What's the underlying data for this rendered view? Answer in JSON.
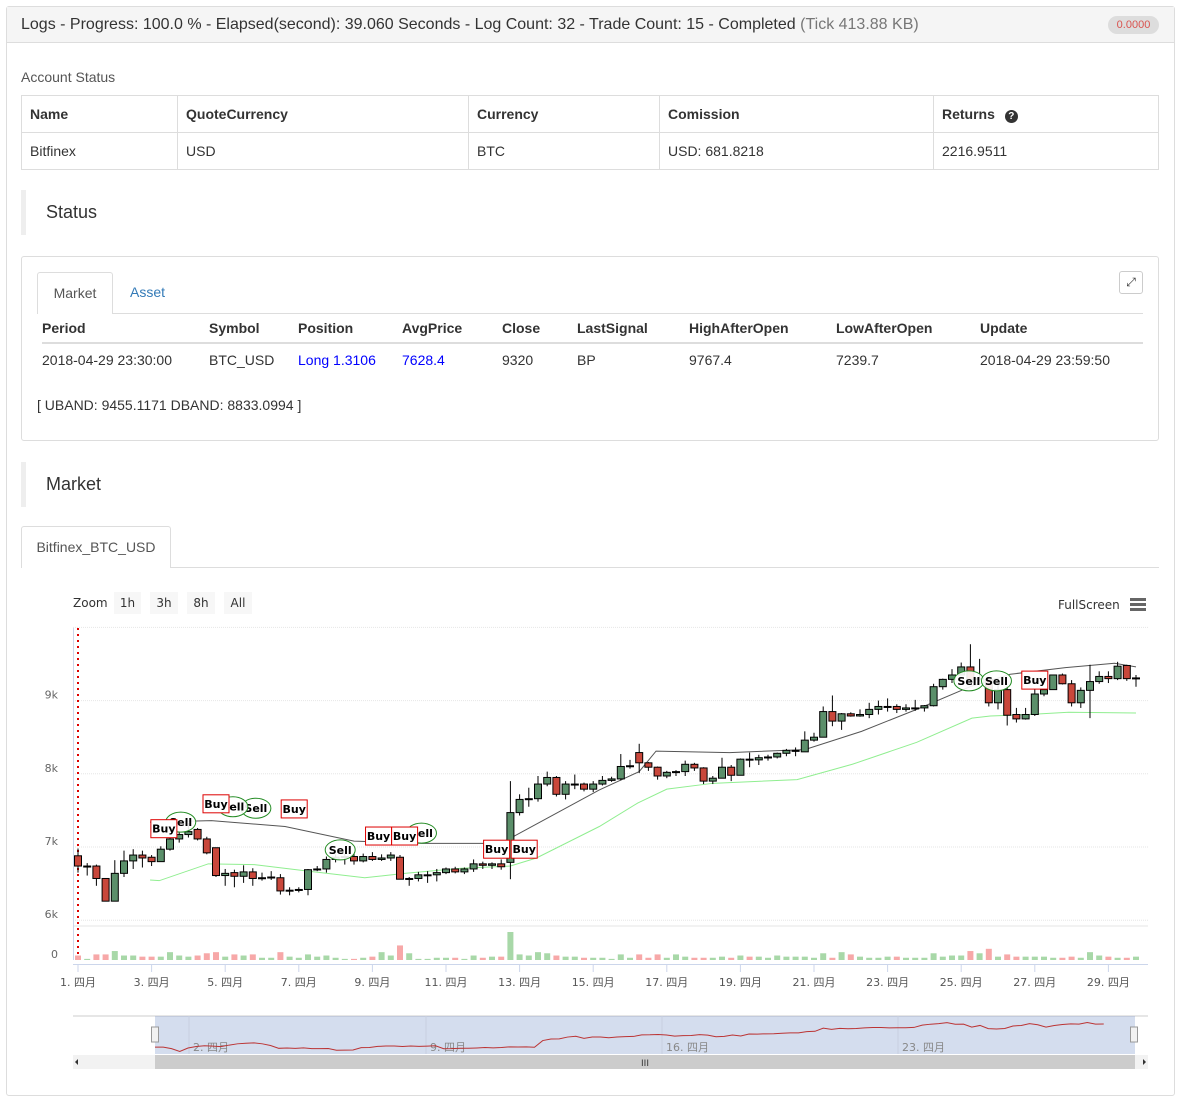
{
  "header": {
    "title": "Logs - Progress: 100.0 % - Elapsed(second): 39.060 Seconds - Log Count: 32 - Trade Count: 15 - Completed",
    "tick": "(Tick 413.88 KB)",
    "badge": "0.0000"
  },
  "account": {
    "label": "Account Status",
    "columns": [
      "Name",
      "QuoteCurrency",
      "Currency",
      "Comission",
      "Returns"
    ],
    "row": [
      "Bitfinex",
      "USD",
      "BTC",
      "USD: 681.8218",
      "2216.9511"
    ],
    "help_icon": "question-circle-icon"
  },
  "status": {
    "title": "Status",
    "tabs": [
      "Market",
      "Asset"
    ],
    "active_tab": "Market",
    "expand_icon": "expand-icon",
    "columns": [
      "Period",
      "Symbol",
      "Position",
      "AvgPrice",
      "Close",
      "LastSignal",
      "HighAfterOpen",
      "LowAfterOpen",
      "Update"
    ],
    "row": [
      "2018-04-29 23:30:00",
      "BTC_USD",
      "Long 1.3106",
      "7628.4",
      "9320",
      "BP",
      "9767.4",
      "7239.7",
      "2018-04-29 23:59:50"
    ],
    "bands": "[ UBAND: 9455.1171 DBAND: 8833.0994 ]",
    "link_color": "#0000ff"
  },
  "market": {
    "title": "Market",
    "tab": "Bitfinex_BTC_USD"
  },
  "chart": {
    "zoom_label": "Zoom",
    "zoom_buttons": [
      "1h",
      "3h",
      "8h",
      "All"
    ],
    "fullscreen": "FullScreen",
    "menu_icon": "hamburger-menu-icon",
    "volume_label": "0",
    "navigator_labels": [
      "2. 四月",
      "9. 四月",
      "16. 四月",
      "23. 四月"
    ],
    "scroll_grip": "III"
  },
  "chart_data": {
    "type": "candlestick",
    "ylim": [
      6000,
      10000
    ],
    "ytick_labels": [
      "6k",
      "7k",
      "8k",
      "9k"
    ],
    "yticks": [
      6000,
      7000,
      8000,
      9000
    ],
    "xtick_labels": [
      "1. 四月",
      "3. 四月",
      "5. 四月",
      "7. 四月",
      "9. 四月",
      "11. 四月",
      "13. 四月",
      "15. 四月",
      "17. 四月",
      "19. 四月",
      "21. 四月",
      "23. 四月",
      "25. 四月",
      "27. 四月",
      "29. 四月"
    ],
    "grid": true,
    "colors": {
      "up": "#5b8f6a",
      "down": "#c9473b",
      "upper_band": "#555555",
      "lower_band": "#90ee90",
      "vol_up": "#a8d8a8",
      "vol_down": "#f7a8a8",
      "buy": "#dd0000",
      "sell": "#228b22"
    },
    "candles": [
      [
        "04-01 00",
        6880,
        6980,
        6650,
        6740
      ],
      [
        "04-01 06",
        6740,
        6780,
        6610,
        6740
      ],
      [
        "04-01 12",
        6740,
        6760,
        6470,
        6570
      ],
      [
        "04-01 18",
        6570,
        6570,
        6260,
        6260
      ],
      [
        "04-02 00",
        6260,
        6820,
        6260,
        6640
      ],
      [
        "04-02 06",
        6640,
        6950,
        6590,
        6810
      ],
      [
        "04-02 12",
        6810,
        6970,
        6700,
        6890
      ],
      [
        "04-02 18",
        6890,
        6950,
        6720,
        6850
      ],
      [
        "04-03 00",
        6860,
        6890,
        6740,
        6800
      ],
      [
        "04-03 06",
        6800,
        7010,
        6800,
        6970
      ],
      [
        "04-03 12",
        6970,
        7170,
        6950,
        7110
      ],
      [
        "04-03 18",
        7110,
        7210,
        7060,
        7170
      ],
      [
        "04-04 00",
        7170,
        7330,
        7130,
        7210
      ],
      [
        "04-04 06",
        7240,
        7260,
        7090,
        7110
      ],
      [
        "04-04 12",
        7110,
        7140,
        6900,
        6920
      ],
      [
        "04-04 18",
        6990,
        6990,
        6590,
        6610
      ],
      [
        "04-05 00",
        6610,
        6700,
        6470,
        6640
      ],
      [
        "04-05 06",
        6650,
        6690,
        6450,
        6600
      ],
      [
        "04-05 12",
        6600,
        6750,
        6510,
        6660
      ],
      [
        "04-05 18",
        6660,
        6710,
        6470,
        6570
      ],
      [
        "04-06 00",
        6570,
        6650,
        6540,
        6580
      ],
      [
        "04-06 06",
        6580,
        6670,
        6550,
        6590
      ],
      [
        "04-06 12",
        6580,
        6630,
        6350,
        6400
      ],
      [
        "04-06 18",
        6400,
        6450,
        6340,
        6410
      ],
      [
        "04-07 00",
        6410,
        6450,
        6380,
        6420
      ],
      [
        "04-07 06",
        6420,
        6700,
        6340,
        6690
      ],
      [
        "04-07 12",
        6690,
        6740,
        6670,
        6700
      ],
      [
        "04-07 18",
        6700,
        6870,
        6650,
        6830
      ],
      [
        "04-08 00",
        6830,
        6900,
        6790,
        6860
      ],
      [
        "04-08 06",
        6860,
        6910,
        6760,
        6870
      ],
      [
        "04-08 12",
        6870,
        6920,
        6760,
        6810
      ],
      [
        "04-08 18",
        6810,
        6910,
        6790,
        6870
      ],
      [
        "04-09 00",
        6870,
        6930,
        6810,
        6830
      ],
      [
        "04-09 06",
        6830,
        6900,
        6810,
        6850
      ],
      [
        "04-09 12",
        6850,
        6930,
        6810,
        6890
      ],
      [
        "04-09 18",
        6860,
        6890,
        6560,
        6560
      ],
      [
        "04-10 00",
        6560,
        6590,
        6470,
        6570
      ],
      [
        "04-10 06",
        6570,
        6660,
        6530,
        6620
      ],
      [
        "04-10 12",
        6620,
        6670,
        6510,
        6620
      ],
      [
        "04-10 18",
        6620,
        6700,
        6530,
        6650
      ],
      [
        "04-11 00",
        6650,
        6720,
        6630,
        6700
      ],
      [
        "04-11 06",
        6700,
        6730,
        6640,
        6660
      ],
      [
        "04-11 12",
        6660,
        6720,
        6630,
        6700
      ],
      [
        "04-11 18",
        6700,
        6830,
        6660,
        6770
      ],
      [
        "04-12 00",
        6770,
        6800,
        6700,
        6750
      ],
      [
        "04-12 06",
        6750,
        6790,
        6700,
        6770
      ],
      [
        "04-12 12",
        6770,
        6830,
        6690,
        6730
      ],
      [
        "04-12 18",
        6790,
        7900,
        6560,
        7470
      ],
      [
        "04-13 00",
        7470,
        7720,
        7430,
        7650
      ],
      [
        "04-13 06",
        7650,
        7810,
        7550,
        7660
      ],
      [
        "04-13 12",
        7660,
        7970,
        7620,
        7860
      ],
      [
        "04-13 18",
        7860,
        8030,
        7830,
        7950
      ],
      [
        "04-14 00",
        7950,
        7970,
        7690,
        7720
      ],
      [
        "04-14 06",
        7720,
        7900,
        7650,
        7860
      ],
      [
        "04-14 12",
        7860,
        7990,
        7790,
        7860
      ],
      [
        "04-14 18",
        7860,
        7880,
        7760,
        7790
      ],
      [
        "04-15 00",
        7790,
        7900,
        7750,
        7860
      ],
      [
        "04-15 06",
        7860,
        7970,
        7840,
        7910
      ],
      [
        "04-15 12",
        7910,
        7960,
        7890,
        7930
      ],
      [
        "04-15 18",
        7930,
        8270,
        7910,
        8100
      ],
      [
        "04-16 00",
        8100,
        8190,
        8070,
        8110
      ],
      [
        "04-16 06",
        8290,
        8410,
        8010,
        8150
      ],
      [
        "04-16 12",
        8150,
        8160,
        8040,
        8090
      ],
      [
        "04-16 18",
        8090,
        8100,
        7920,
        7970
      ],
      [
        "04-17 00",
        7970,
        8040,
        7940,
        8020
      ],
      [
        "04-17 06",
        8020,
        8050,
        7970,
        8030
      ],
      [
        "04-17 12",
        8030,
        8180,
        7970,
        8130
      ],
      [
        "04-17 18",
        8130,
        8150,
        8040,
        8080
      ],
      [
        "04-18 00",
        8080,
        8090,
        7860,
        7900
      ],
      [
        "04-18 06",
        7900,
        7970,
        7860,
        7940
      ],
      [
        "04-18 12",
        7940,
        8220,
        7940,
        8090
      ],
      [
        "04-18 18",
        8090,
        8120,
        7900,
        7980
      ],
      [
        "04-19 00",
        7980,
        8210,
        7980,
        8200
      ],
      [
        "04-19 06",
        8200,
        8290,
        8090,
        8190
      ],
      [
        "04-19 12",
        8190,
        8260,
        8120,
        8220
      ],
      [
        "04-19 18",
        8220,
        8260,
        8180,
        8230
      ],
      [
        "04-20 00",
        8230,
        8290,
        8210,
        8280
      ],
      [
        "04-20 06",
        8280,
        8340,
        8240,
        8320
      ],
      [
        "04-20 12",
        8320,
        8360,
        8240,
        8320
      ],
      [
        "04-20 18",
        8300,
        8580,
        8300,
        8460
      ],
      [
        "04-21 00",
        8460,
        8560,
        8440,
        8500
      ],
      [
        "04-21 06",
        8500,
        8920,
        8500,
        8850
      ],
      [
        "04-21 12",
        8850,
        9070,
        8650,
        8720
      ],
      [
        "04-21 18",
        8720,
        8830,
        8600,
        8820
      ],
      [
        "04-22 00",
        8820,
        8840,
        8780,
        8790
      ],
      [
        "04-22 06",
        8790,
        8880,
        8780,
        8810
      ],
      [
        "04-22 12",
        8810,
        8970,
        8760,
        8880
      ],
      [
        "04-22 18",
        8880,
        9000,
        8810,
        8920
      ],
      [
        "04-23 00",
        8920,
        9030,
        8850,
        8920
      ],
      [
        "04-23 06",
        8920,
        8950,
        8830,
        8880
      ],
      [
        "04-23 12",
        8880,
        8950,
        8850,
        8900
      ],
      [
        "04-23 18",
        8900,
        9010,
        8860,
        8900
      ],
      [
        "04-24 00",
        8900,
        8940,
        8850,
        8930
      ],
      [
        "04-24 06",
        8930,
        9230,
        8920,
        9190
      ],
      [
        "04-24 12",
        9190,
        9300,
        9150,
        9290
      ],
      [
        "04-24 18",
        9290,
        9430,
        9240,
        9350
      ],
      [
        "04-25 00",
        9350,
        9520,
        9350,
        9460
      ],
      [
        "04-25 06",
        9460,
        9770,
        9280,
        9290
      ],
      [
        "04-25 12",
        9290,
        9570,
        9260,
        9300
      ],
      [
        "04-25 18",
        9290,
        9300,
        8920,
        8970
      ],
      [
        "04-26 00",
        8970,
        9300,
        8880,
        9150
      ],
      [
        "04-26 06",
        9150,
        9200,
        8660,
        8800
      ],
      [
        "04-26 12",
        8810,
        8900,
        8700,
        8750
      ],
      [
        "04-26 18",
        8750,
        8900,
        8740,
        8810
      ],
      [
        "04-27 00",
        8810,
        9200,
        8790,
        9090
      ],
      [
        "04-27 06",
        9090,
        9250,
        9060,
        9150
      ],
      [
        "04-27 12",
        9150,
        9350,
        9150,
        9350
      ],
      [
        "04-27 18",
        9350,
        9370,
        9220,
        9230
      ],
      [
        "04-28 00",
        9230,
        9280,
        8920,
        8970
      ],
      [
        "04-28 06",
        8970,
        9180,
        8900,
        9140
      ],
      [
        "04-28 12",
        9140,
        9490,
        8760,
        9260
      ],
      [
        "04-28 18",
        9260,
        9400,
        9230,
        9330
      ],
      [
        "04-29 00",
        9330,
        9400,
        9240,
        9300
      ],
      [
        "04-29 06",
        9300,
        9530,
        9280,
        9470
      ],
      [
        "04-29 12",
        9480,
        9490,
        9270,
        9300
      ],
      [
        "04-29 18",
        9300,
        9350,
        9190,
        9310
      ]
    ],
    "volumes": [
      4,
      1,
      5,
      5,
      8,
      4,
      4,
      3,
      3,
      3,
      7,
      4,
      3,
      4,
      6,
      7,
      3,
      5,
      4,
      5,
      2,
      2,
      7,
      3,
      2,
      5,
      3,
      4,
      2,
      1,
      1,
      2,
      3,
      7,
      4,
      13,
      6,
      1,
      1,
      2,
      2,
      2,
      1,
      4,
      2,
      3,
      3,
      25,
      5,
      4,
      7,
      6,
      4,
      3,
      3,
      2,
      2,
      2,
      1,
      5,
      2,
      5,
      2,
      5,
      2,
      5,
      3,
      2,
      2,
      2,
      3,
      2,
      4,
      3,
      3,
      2,
      4,
      3,
      3,
      3,
      2,
      6,
      2,
      7,
      5,
      3,
      2,
      2,
      3,
      3,
      2,
      2,
      2,
      6,
      3,
      4,
      4,
      8,
      6,
      10,
      3,
      5,
      3,
      3,
      3,
      3,
      2,
      2,
      3,
      2,
      7,
      4,
      3,
      2,
      2,
      3
    ],
    "upper_band": [
      [
        "04-02 23",
        7340
      ],
      [
        "04-04 15",
        7360
      ],
      [
        "04-06 15",
        7280
      ],
      [
        "04-08 12",
        7080
      ],
      [
        "04-10 09",
        7050
      ],
      [
        "04-12 11",
        7050
      ],
      [
        "04-12 18",
        7120
      ],
      [
        "04-15 04",
        7780
      ],
      [
        "04-16 06",
        8030
      ],
      [
        "04-16 17",
        8310
      ],
      [
        "04-18 17",
        8290
      ],
      [
        "04-20 18",
        8330
      ],
      [
        "04-22 07",
        8580
      ],
      [
        "04-23 19",
        8880
      ],
      [
        "04-25 07",
        9200
      ],
      [
        "04-26 08",
        9360
      ],
      [
        "04-27 20",
        9450
      ],
      [
        "04-29 04",
        9510
      ],
      [
        "04-29 18",
        9460
      ]
    ],
    "lower_band": [
      [
        "04-02 23",
        6550
      ],
      [
        "04-03 05",
        6540
      ],
      [
        "04-04 13",
        6770
      ],
      [
        "04-05 19",
        6760
      ],
      [
        "04-07 06",
        6670
      ],
      [
        "04-08 19",
        6580
      ],
      [
        "04-09 21",
        6640
      ],
      [
        "04-11 10",
        6710
      ],
      [
        "04-12 18",
        6740
      ],
      [
        "04-13 11",
        6850
      ],
      [
        "04-15 04",
        7280
      ],
      [
        "04-16 05",
        7600
      ],
      [
        "04-17 00",
        7790
      ],
      [
        "04-18 06",
        7870
      ],
      [
        "04-20 13",
        7920
      ],
      [
        "04-22 01",
        8130
      ],
      [
        "04-23 19",
        8430
      ],
      [
        "04-25 07",
        8760
      ],
      [
        "04-25 19",
        8790
      ],
      [
        "04-26 20",
        8810
      ],
      [
        "04-27 22",
        8840
      ],
      [
        "04-29 18",
        8830
      ]
    ],
    "signals": [
      {
        "time": "04-03 19",
        "price": 7340,
        "type": "sell",
        "text": "Sell"
      },
      {
        "time": "04-03 08",
        "price": 7250,
        "type": "buy",
        "text": "Buy"
      },
      {
        "time": "04-05 20",
        "price": 7530,
        "type": "sell",
        "text": "Sell"
      },
      {
        "time": "04-05 05",
        "price": 7550,
        "type": "sell",
        "text": "Sell"
      },
      {
        "time": "04-04 18",
        "price": 7590,
        "type": "buy",
        "text": "Buy"
      },
      {
        "time": "04-06 21",
        "price": 7520,
        "type": "buy",
        "text": "Buy"
      },
      {
        "time": "04-08 03",
        "price": 6960,
        "type": "sell",
        "text": "Sell"
      },
      {
        "time": "04-10 08",
        "price": 7190,
        "type": "sell",
        "text": "Sell"
      },
      {
        "time": "04-09 21",
        "price": 7150,
        "type": "buy",
        "text": "Buy"
      },
      {
        "time": "04-09 04",
        "price": 7150,
        "type": "buy",
        "text": "Buy"
      },
      {
        "time": "04-12 09",
        "price": 6970,
        "type": "buy",
        "text": "Buy"
      },
      {
        "time": "04-13 03",
        "price": 6970,
        "type": "buy",
        "text": "Buy"
      },
      {
        "time": "04-25 05",
        "price": 9270,
        "type": "sell",
        "text": "Sell"
      },
      {
        "time": "04-25 23",
        "price": 9270,
        "type": "sell",
        "text": "Sell"
      },
      {
        "time": "04-27 00",
        "price": 9280,
        "type": "buy",
        "text": "Buy"
      }
    ]
  }
}
